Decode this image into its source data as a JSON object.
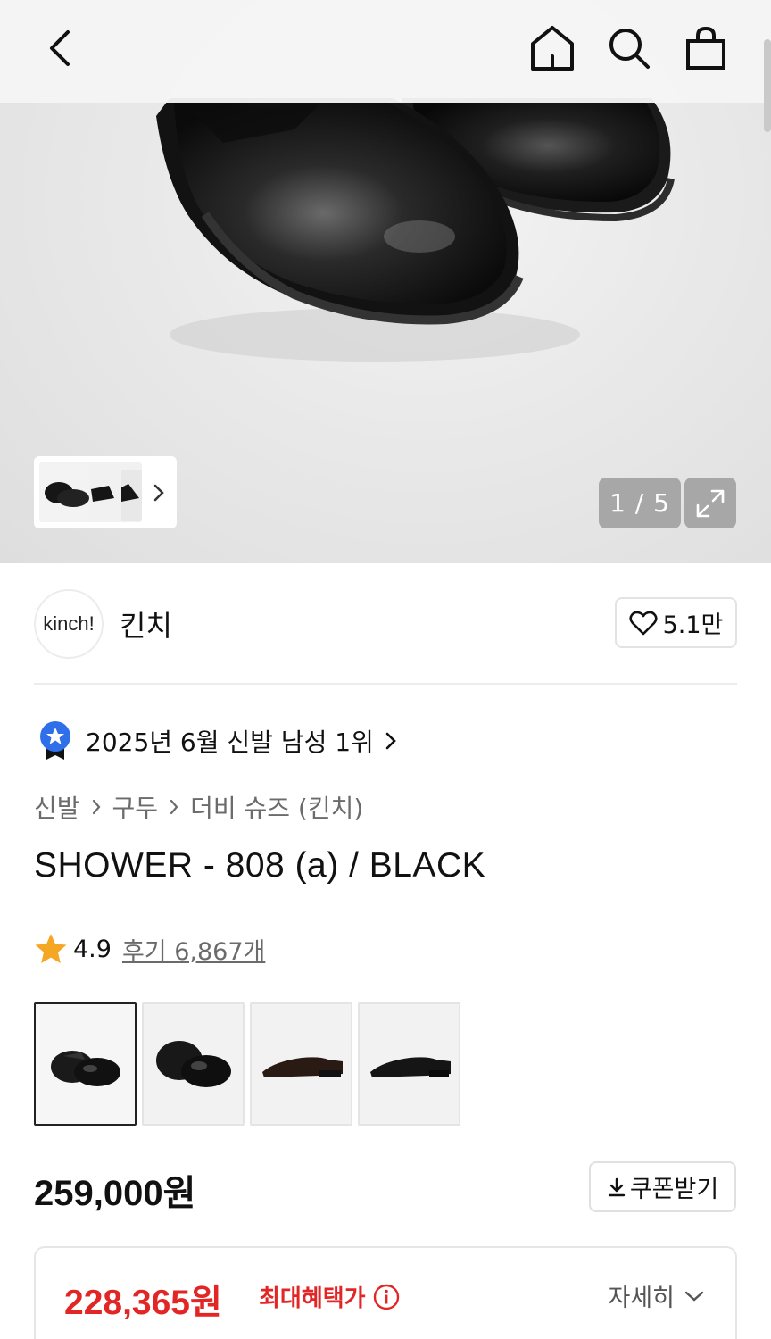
{
  "topbar": {
    "back_icon": "chevron-left-icon",
    "home_icon": "home-icon",
    "search_icon": "search-icon",
    "cart_icon": "shopping-bag-icon"
  },
  "gallery": {
    "current": "1",
    "total": "5",
    "counter_text": "1 / 5",
    "expand_icon": "expand-icon"
  },
  "brand": {
    "logo_text": "kinch!",
    "name": "킨치",
    "likes": "5.1만"
  },
  "ranking": {
    "text": "2025년 6월 신발 남성 1위"
  },
  "breadcrumb": [
    "신발",
    "구두",
    "더비 슈즈 (킨치)"
  ],
  "product": {
    "title": "SHOWER - 808 (a) / BLACK",
    "rating": "4.9",
    "review_text": "후기 6,867개",
    "price": "259,000원",
    "coupon_label": "쿠폰받기",
    "selected_option_index": 0
  },
  "benefit": {
    "price": "228,365원",
    "label": "최대혜택가",
    "more": "자세히"
  },
  "colors": {
    "accent_red": "#e22626",
    "star": "#f5a623",
    "badge_blue": "#2f6fea"
  }
}
